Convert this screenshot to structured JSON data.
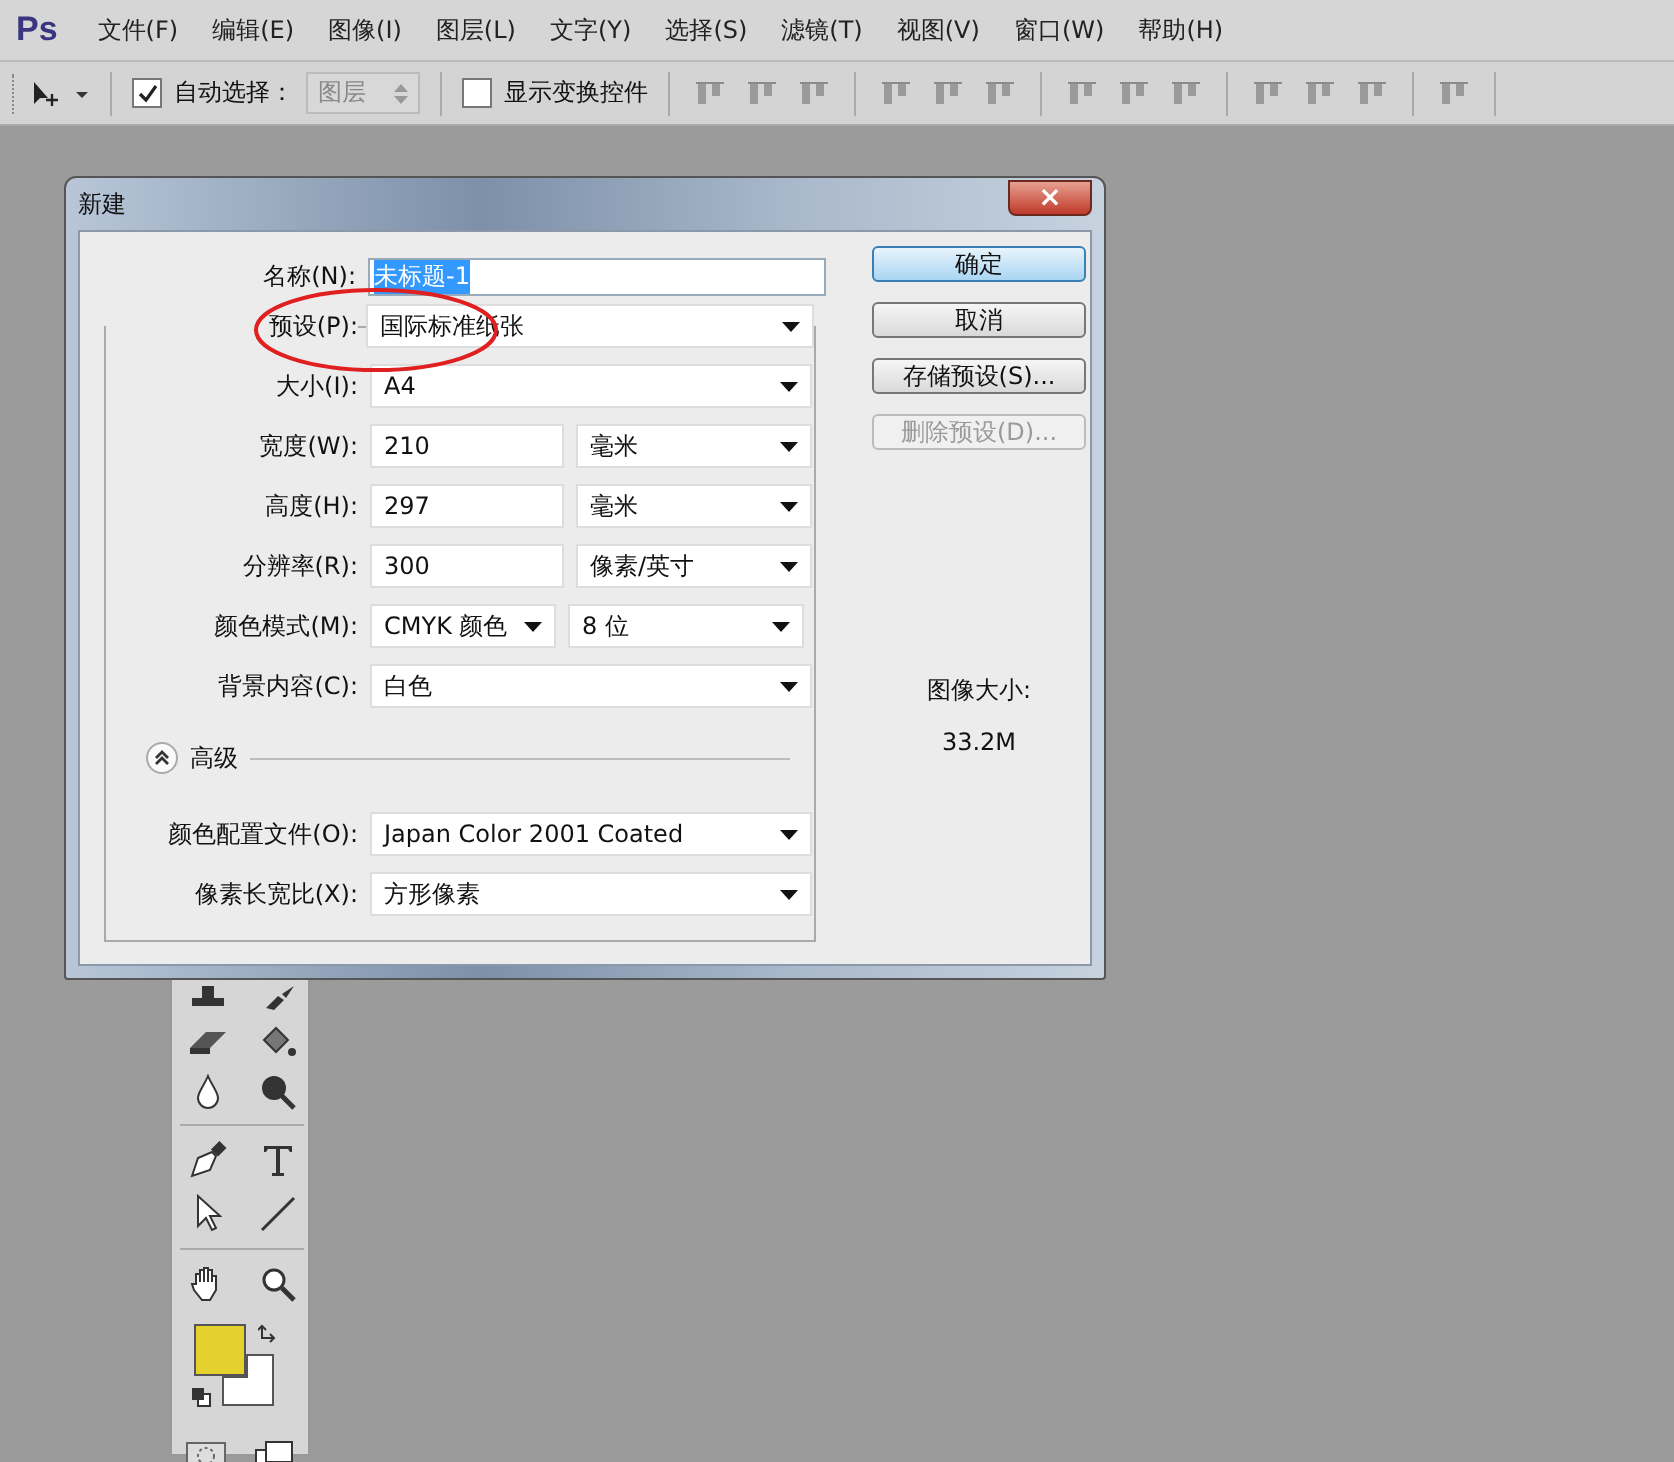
{
  "app_logo": "Ps",
  "menu": [
    "文件(F)",
    "编辑(E)",
    "图像(I)",
    "图层(L)",
    "文字(Y)",
    "选择(S)",
    "滤镜(T)",
    "视图(V)",
    "窗口(W)",
    "帮助(H)"
  ],
  "options_bar": {
    "auto_select": {
      "label": "自动选择：",
      "checked": true,
      "value": "图层"
    },
    "show_transform": {
      "label": "显示变换控件",
      "checked": false
    }
  },
  "dialog": {
    "title": "新建",
    "close": "×",
    "name": {
      "label": "名称(N):",
      "value": "未标题-1"
    },
    "preset": {
      "label": "预设(P):",
      "value": "国际标准纸张"
    },
    "fields": [
      {
        "kind": "select",
        "label": "大小(I):",
        "value": "A4"
      },
      {
        "kind": "input_unit",
        "label": "宽度(W):",
        "value": "210",
        "unit": "毫米"
      },
      {
        "kind": "input_unit",
        "label": "高度(H):",
        "value": "297",
        "unit": "毫米"
      },
      {
        "kind": "input_unit",
        "label": "分辨率(R):",
        "value": "300",
        "unit": "像素/英寸"
      },
      {
        "kind": "select_pair",
        "label": "颜色模式(M):",
        "value": "CMYK 颜色",
        "unit": "8 位"
      },
      {
        "kind": "select",
        "label": "背景内容(C):",
        "value": "白色"
      }
    ],
    "advanced": {
      "label": "高级",
      "expanded": true
    },
    "advanced_fields": [
      {
        "kind": "select",
        "label": "颜色配置文件(O):",
        "value": "Japan Color 2001 Coated"
      },
      {
        "kind": "select",
        "label": "像素长宽比(X):",
        "value": "方形像素"
      }
    ],
    "buttons": [
      {
        "label": "确定",
        "disabled": false,
        "default": true
      },
      {
        "label": "取消",
        "disabled": false,
        "default": false
      },
      {
        "label": "存储预设(S)...",
        "disabled": false,
        "default": false
      },
      {
        "label": "删除预设(D)...",
        "disabled": true,
        "default": false
      }
    ],
    "image_size": {
      "label": "图像大小:",
      "value": "33.2M"
    }
  },
  "toolbox": {
    "swatches": [
      {
        "color": "#e4d12e"
      },
      {
        "color": "#ffffff"
      }
    ]
  }
}
